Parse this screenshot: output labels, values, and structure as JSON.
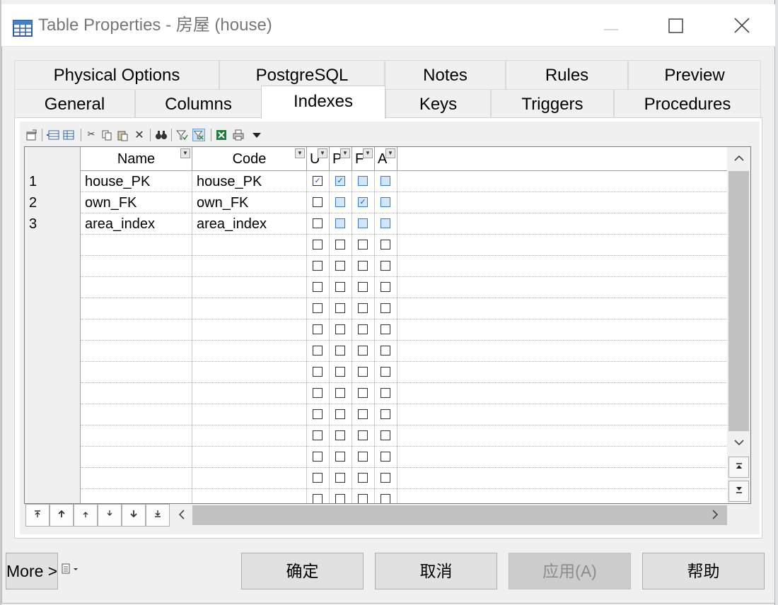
{
  "window": {
    "title": "Table Properties - 房屋 (house)"
  },
  "tabs": {
    "row1": [
      {
        "label": "Physical Options"
      },
      {
        "label": "PostgreSQL"
      },
      {
        "label": "Notes"
      },
      {
        "label": "Rules"
      },
      {
        "label": "Preview"
      }
    ],
    "row2": [
      {
        "label": "General"
      },
      {
        "label": "Columns"
      },
      {
        "label": "Indexes",
        "active": true
      },
      {
        "label": "Keys"
      },
      {
        "label": "Triggers"
      },
      {
        "label": "Procedures"
      }
    ]
  },
  "toolbar": {
    "icons": [
      "properties-icon",
      "add-row-icon",
      "insert-row-icon",
      "cut-icon",
      "copy-icon",
      "paste-icon",
      "delete-icon",
      "find-icon",
      "filter-icon",
      "customize-columns-icon",
      "excel-export-icon",
      "print-icon",
      "dropdown-arrow-icon"
    ]
  },
  "grid": {
    "columns": [
      {
        "label": "Name"
      },
      {
        "label": "Code"
      },
      {
        "label": "U"
      },
      {
        "label": "P"
      },
      {
        "label": "F"
      },
      {
        "label": "A"
      }
    ],
    "rows": [
      {
        "num": "1",
        "name": "house_PK",
        "code": "house_PK",
        "checks": [
          "checked",
          "checked-blue",
          "blue",
          "blue"
        ]
      },
      {
        "num": "2",
        "name": "own_FK",
        "code": "own_FK",
        "checks": [
          "empty",
          "blue",
          "checked-blue",
          "blue"
        ]
      },
      {
        "num": "3",
        "name": "area_index",
        "code": "area_index",
        "checks": [
          "empty",
          "blue",
          "blue",
          "blue"
        ]
      }
    ],
    "empty_row_count": 13
  },
  "buttons": {
    "more": "More >>",
    "ok": "确定",
    "cancel": "取消",
    "apply": "应用(A)",
    "help": "帮助"
  },
  "colors": {
    "accent": "#1a5aa8",
    "check_blue_fill": "#cfe6fb",
    "scroll_thumb": "#c1c1c1"
  }
}
